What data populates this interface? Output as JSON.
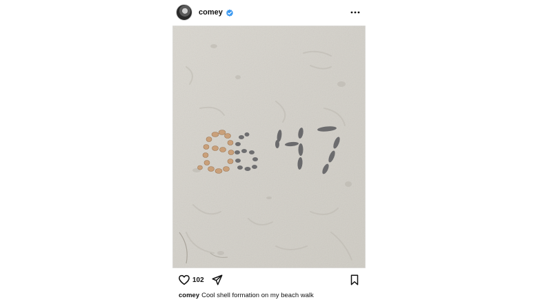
{
  "post": {
    "username": "comey",
    "verified": true,
    "likes": "102",
    "caption_user": "comey",
    "caption_text": "Cool shell formation on my beach walk"
  },
  "photo": {
    "description_icon": "beach-sand-shells-photo",
    "sand_color": "#d6d3cc",
    "shell_color": "#c9a07a",
    "stone_color": "#6e6e70"
  },
  "icons": {
    "verified": "verified-badge-icon",
    "more": "more-horizontal-icon",
    "like": "heart-icon",
    "share": "send-icon",
    "save": "bookmark-icon"
  },
  "colors": {
    "verified_blue": "#3897f0",
    "text": "#111111"
  }
}
